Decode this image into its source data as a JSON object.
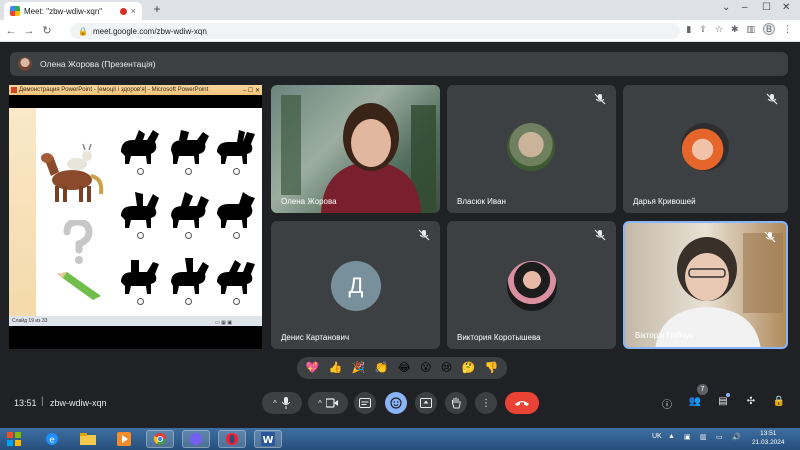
{
  "browser": {
    "tab_title": "Meet: \"zbw-wdiw-xqn\"",
    "tab_close": "×",
    "new_tab": "+",
    "url": "meet.google.com/zbw-wdiw-xqn",
    "profile_initial": "B"
  },
  "presenter_bar": {
    "label": "Олена Жорова (Презентація)"
  },
  "slide": {
    "window_title": "Демонстрация PowerPoint - [емоції і здоров'я] - Microsoft PowerPoint",
    "status_text": "Слайд 19 из 33"
  },
  "participants": [
    {
      "name": "Олена Жорова",
      "muted": false
    },
    {
      "name": "Власюк Иван",
      "muted": true
    },
    {
      "name": "Дарья Кривошей",
      "muted": true
    },
    {
      "name": "Денис Картанович",
      "initial": "Д",
      "muted": true
    },
    {
      "name": "Виктория Коротышева",
      "muted": true
    },
    {
      "name": "Вікторія Глібчук",
      "muted": true
    }
  ],
  "reactions": [
    "💖",
    "👍",
    "🎉",
    "👏",
    "😂",
    "😮",
    "😢",
    "🤔",
    "👎"
  ],
  "controls": {
    "time": "13:51",
    "separator": "|",
    "meeting_code": "zbw-wdiw-xqn",
    "people_count": "7"
  },
  "taskbar": {
    "lang": "UK",
    "clock_time": "13:51",
    "clock_date": "21.03.2024"
  },
  "colors": {
    "meet_bg": "#202124",
    "tile_bg": "#3c4043",
    "accent": "#8ab4f8",
    "hangup": "#ea4335",
    "avatar_letter_bg": "#78909c"
  },
  "icons": [
    "mic-off-icon",
    "mic-icon",
    "camera-icon",
    "captions-icon",
    "emoji-icon",
    "present-icon",
    "raise-hand-icon",
    "more-icon",
    "hangup-icon",
    "info-icon",
    "people-icon",
    "chat-icon",
    "activities-icon",
    "host-controls-icon"
  ]
}
